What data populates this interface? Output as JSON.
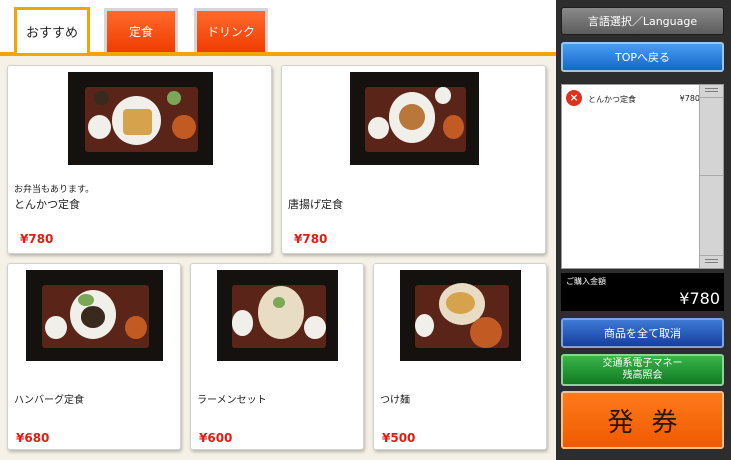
{
  "tabs": [
    {
      "label": "おすすめ",
      "active": true
    },
    {
      "label": "定食",
      "active": false
    },
    {
      "label": "ドリンク",
      "active": false
    }
  ],
  "products": [
    {
      "note": "お弁当もあります。",
      "name": "とんかつ定食",
      "price": "¥780"
    },
    {
      "name": "唐揚げ定食",
      "price": "¥780"
    },
    {
      "name": "ハンバーグ定食",
      "price": "¥680"
    },
    {
      "name": "ラーメンセット",
      "price": "¥600"
    },
    {
      "name": "つけ麺",
      "price": "¥500"
    }
  ],
  "panel": {
    "language_button": "言語選択／Language",
    "top_button": "TOPへ戻る",
    "cart": [
      {
        "name": "とんかつ定食",
        "price": "¥780",
        "remove_icon": "×"
      }
    ],
    "total_label": "ご購入金額",
    "total_value": "¥780",
    "clear_button": "商品を全て取消",
    "ic_button_line1": "交通系電子マネー",
    "ic_button_line2": "残高照会",
    "issue_button": "発券"
  },
  "colors": {
    "accent": "#f2a500",
    "price": "#e21d10",
    "tab_red": "#f03c00",
    "issue": "#f05a00"
  }
}
